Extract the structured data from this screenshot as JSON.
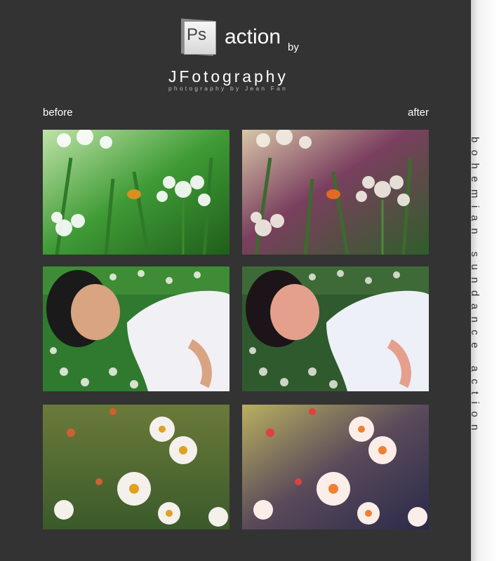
{
  "header": {
    "logo_text": "Ps",
    "title": "action",
    "by": "by",
    "brand": "JFotography",
    "tagline": "photography by Jean Fan"
  },
  "labels": {
    "before": "before",
    "after": "after"
  },
  "sidebar": {
    "text": "bohemian sundance action"
  },
  "photos": [
    {
      "subject": "bee on white flower",
      "variant": "before"
    },
    {
      "subject": "bee on white flower",
      "variant": "after"
    },
    {
      "subject": "woman lying in flowers",
      "variant": "before"
    },
    {
      "subject": "woman lying in flowers",
      "variant": "after"
    },
    {
      "subject": "daisies",
      "variant": "before"
    },
    {
      "subject": "daisies",
      "variant": "after"
    }
  ]
}
